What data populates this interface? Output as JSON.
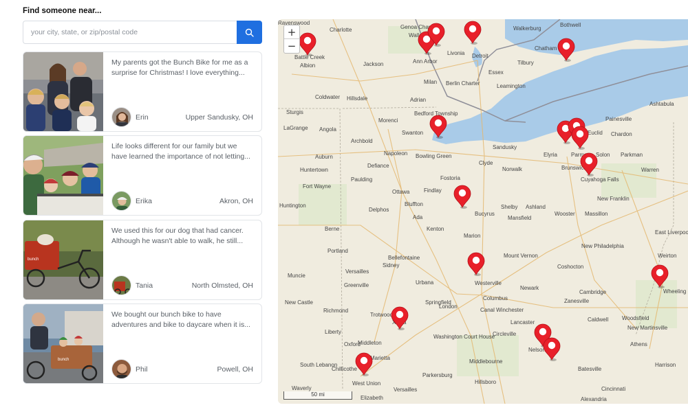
{
  "finder": {
    "heading": "Find someone near...",
    "search_placeholder": "your city, state, or zip/postal code",
    "search_icon": "search-icon",
    "accent_color": "#1f6fe0"
  },
  "testimonials": [
    {
      "quote": "My parents got the Bunch Bike for me as a surprise for Christmas! I love everything...",
      "name": "Erin",
      "location": "Upper Sandusky, OH"
    },
    {
      "quote": "Life looks different for our family but we have learned the importance of not letting...",
      "name": "Erika",
      "location": "Akron, OH"
    },
    {
      "quote": "We used this for our dog that had cancer. Although he wasn't able to walk, he still...",
      "name": "Tania",
      "location": "North Olmsted, OH"
    },
    {
      "quote": "We bought our bunch bike to have adventures and bike to daycare when it is...",
      "name": "Phil",
      "location": "Powell, OH"
    }
  ],
  "map": {
    "zoom_in": "+",
    "zoom_out": "−",
    "scale_label": "50 mi",
    "marker_color": "#e8202a",
    "water_color": "#a9cbe8",
    "cities": [
      {
        "name": "Charlotte"
      },
      {
        "name": "Genoa Charter"
      },
      {
        "name": "Walled Lake"
      },
      {
        "name": "Walkerburg"
      },
      {
        "name": "Bothwell"
      },
      {
        "name": "Battle Creek"
      },
      {
        "name": "Jackson"
      },
      {
        "name": "Ann Arbor"
      },
      {
        "name": "Livonia"
      },
      {
        "name": "Detroit"
      },
      {
        "name": "Chatham"
      },
      {
        "name": "Albion"
      },
      {
        "name": "Tilbury"
      },
      {
        "name": "Essex"
      },
      {
        "name": "Milan"
      },
      {
        "name": "Leamington"
      },
      {
        "name": "Berlin Charter"
      },
      {
        "name": "Coldwater"
      },
      {
        "name": "Hillsdale"
      },
      {
        "name": "Adrian"
      },
      {
        "name": "Sturgis"
      },
      {
        "name": "Bedford Township"
      },
      {
        "name": "Ashtabula"
      },
      {
        "name": "Morenci"
      },
      {
        "name": "Painesville"
      },
      {
        "name": "LaGrange"
      },
      {
        "name": "Angola"
      },
      {
        "name": "Swanton"
      },
      {
        "name": "Euclid"
      },
      {
        "name": "Chardon"
      },
      {
        "name": "Archbold"
      },
      {
        "name": "Sandusky"
      },
      {
        "name": "Elyria"
      },
      {
        "name": "Parma"
      },
      {
        "name": "Solon"
      },
      {
        "name": "Parkman"
      },
      {
        "name": "Auburn"
      },
      {
        "name": "Napoleon"
      },
      {
        "name": "Bowling Green"
      },
      {
        "name": "Clyde"
      },
      {
        "name": "Huntertown"
      },
      {
        "name": "Defiance"
      },
      {
        "name": "Norwalk"
      },
      {
        "name": "Brunswick"
      },
      {
        "name": "Warren"
      },
      {
        "name": "Fostoria"
      },
      {
        "name": "Cuyahoga Falls"
      },
      {
        "name": "Fort Wayne"
      },
      {
        "name": "Paulding"
      },
      {
        "name": "Ottawa"
      },
      {
        "name": "Findlay"
      },
      {
        "name": "Huntington"
      },
      {
        "name": "Bluffton"
      },
      {
        "name": "Shelby"
      },
      {
        "name": "Ashland"
      },
      {
        "name": "New Franklin"
      },
      {
        "name": "Delphos"
      },
      {
        "name": "Bucyrus"
      },
      {
        "name": "Wooster"
      },
      {
        "name": "Massillon"
      },
      {
        "name": "Ada"
      },
      {
        "name": "Mansfield"
      },
      {
        "name": "East Liverpool"
      },
      {
        "name": "Berne"
      },
      {
        "name": "Kenton"
      },
      {
        "name": "Marion"
      },
      {
        "name": "New Philadelphia"
      },
      {
        "name": "Portland"
      },
      {
        "name": "Mount Vernon"
      },
      {
        "name": "Weirton"
      },
      {
        "name": "Bellefontaine"
      },
      {
        "name": "Coshocton"
      },
      {
        "name": "Versailles"
      },
      {
        "name": "Sidney"
      },
      {
        "name": "Muncie"
      },
      {
        "name": "Westerville"
      },
      {
        "name": "Newark"
      },
      {
        "name": "Cambridge"
      },
      {
        "name": "Wheeling"
      },
      {
        "name": "Greenville"
      },
      {
        "name": "Urbana"
      },
      {
        "name": "Columbus"
      },
      {
        "name": "Zanesville"
      },
      {
        "name": "New Castle"
      },
      {
        "name": "Springfield"
      },
      {
        "name": "London"
      },
      {
        "name": "Canal Winchester"
      },
      {
        "name": "Richmond"
      },
      {
        "name": "Trotwood"
      },
      {
        "name": "Xenia"
      },
      {
        "name": "Lancaster"
      },
      {
        "name": "Caldwell"
      },
      {
        "name": "Woodsfield"
      },
      {
        "name": "New Martinsville"
      },
      {
        "name": "Liberty"
      },
      {
        "name": "Washington Court House"
      },
      {
        "name": "Circleville"
      },
      {
        "name": "Middleton"
      },
      {
        "name": "Oxford"
      },
      {
        "name": "Nelsonville"
      },
      {
        "name": "Athens"
      },
      {
        "name": "Marietta"
      },
      {
        "name": "Middlebourne"
      },
      {
        "name": "South Lebanon"
      },
      {
        "name": "Chillicothe"
      },
      {
        "name": "Batesville"
      },
      {
        "name": "Harrison"
      },
      {
        "name": "Parkersburg"
      },
      {
        "name": "West Union"
      },
      {
        "name": "Hillsboro"
      },
      {
        "name": "Cincinnati"
      },
      {
        "name": "Waverly"
      },
      {
        "name": "Elizabeth"
      },
      {
        "name": "Versailles"
      },
      {
        "name": "Alexandria"
      },
      {
        "name": "Ravenswood"
      }
    ],
    "markers": [
      {
        "label": "Battle Creek area"
      },
      {
        "label": "Ann Arbor"
      },
      {
        "label": "Livonia"
      },
      {
        "label": "Detroit"
      },
      {
        "label": "Chatham"
      },
      {
        "label": "Swanton"
      },
      {
        "label": "Cleveland"
      },
      {
        "label": "Cleveland"
      },
      {
        "label": "Parma"
      },
      {
        "label": "Cuyahoga Falls"
      },
      {
        "label": "Upper Sandusky"
      },
      {
        "label": "Delaware"
      },
      {
        "label": "Wheeling"
      },
      {
        "label": "Xenia"
      },
      {
        "label": "Nelsonville"
      },
      {
        "label": "Athens"
      },
      {
        "label": "Cincinnati"
      }
    ]
  }
}
